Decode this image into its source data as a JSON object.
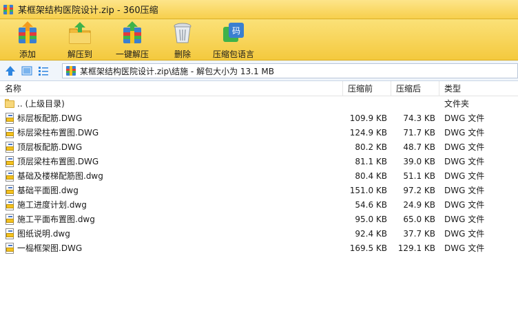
{
  "window": {
    "title": "某框架结构医院设计.zip - 360压缩"
  },
  "toolbar": {
    "buttons": [
      {
        "label": "添加",
        "icon": "add-archive-icon"
      },
      {
        "label": "解压到",
        "icon": "extract-to-icon"
      },
      {
        "label": "一键解压",
        "icon": "quick-extract-icon"
      },
      {
        "label": "删除",
        "icon": "trash-icon"
      },
      {
        "label": "压缩包语言",
        "icon": "language-icon",
        "badge": "码"
      }
    ]
  },
  "addressbar": {
    "path": "某框架结构医院设计.zip\\结施 - 解包大小为 13.1 MB",
    "nav_icons": [
      "up-arrow-icon",
      "large-icons-view-icon",
      "details-view-icon"
    ]
  },
  "list": {
    "columns": {
      "name": "名称",
      "compressed": "压缩前",
      "original": "压缩后",
      "type": "类型"
    },
    "rows": [
      {
        "name": ".. (上级目录)",
        "compressed": "",
        "original": "",
        "type": "文件夹",
        "icon": "folder-icon"
      },
      {
        "name": "标层板配筋.DWG",
        "compressed": "109.9 KB",
        "original": "74.3 KB",
        "type": "DWG 文件",
        "icon": "dwg-file-icon"
      },
      {
        "name": "标层梁柱布置图.DWG",
        "compressed": "124.9 KB",
        "original": "71.7 KB",
        "type": "DWG 文件",
        "icon": "dwg-file-icon"
      },
      {
        "name": "顶层板配筋.DWG",
        "compressed": "80.2 KB",
        "original": "48.7 KB",
        "type": "DWG 文件",
        "icon": "dwg-file-icon"
      },
      {
        "name": "顶层梁柱布置图.DWG",
        "compressed": "81.1 KB",
        "original": "39.0 KB",
        "type": "DWG 文件",
        "icon": "dwg-file-icon"
      },
      {
        "name": "基础及楼梯配筋图.dwg",
        "compressed": "80.4 KB",
        "original": "51.1 KB",
        "type": "DWG 文件",
        "icon": "dwg-file-icon"
      },
      {
        "name": "基础平面图.dwg",
        "compressed": "151.0 KB",
        "original": "97.2 KB",
        "type": "DWG 文件",
        "icon": "dwg-file-icon"
      },
      {
        "name": "施工进度计划.dwg",
        "compressed": "54.6 KB",
        "original": "24.9 KB",
        "type": "DWG 文件",
        "icon": "dwg-file-icon"
      },
      {
        "name": "施工平面布置图.dwg",
        "compressed": "95.0 KB",
        "original": "65.0 KB",
        "type": "DWG 文件",
        "icon": "dwg-file-icon"
      },
      {
        "name": "图纸说明.dwg",
        "compressed": "92.4 KB",
        "original": "37.7 KB",
        "type": "DWG 文件",
        "icon": "dwg-file-icon"
      },
      {
        "name": "一榀框架图.DWG",
        "compressed": "169.5 KB",
        "original": "129.1 KB",
        "type": "DWG 文件",
        "icon": "dwg-file-icon"
      }
    ]
  }
}
